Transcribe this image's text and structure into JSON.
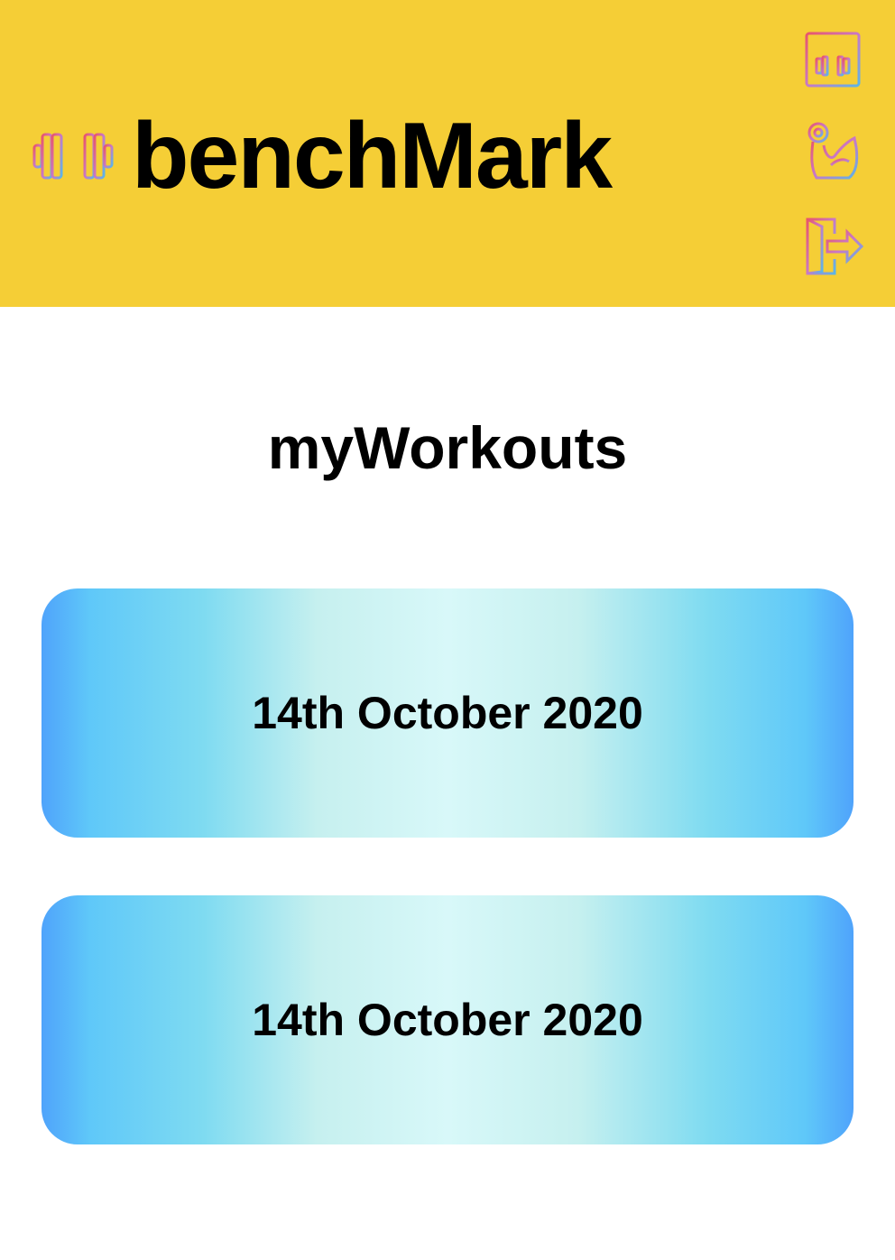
{
  "header": {
    "title": "benchMark",
    "logo_icon": "barbell-icon",
    "background_color": "#F5CE36",
    "nav": [
      {
        "icon": "calendar-workout-icon"
      },
      {
        "icon": "flexed-arm-icon"
      },
      {
        "icon": "logout-icon"
      }
    ]
  },
  "main": {
    "title": "myWorkouts",
    "workouts": [
      {
        "date": "14th October 2020"
      },
      {
        "date": "14th October 2020"
      }
    ]
  },
  "colors": {
    "card_edge": "#4FA3FB",
    "card_center": "#D8F8F9"
  }
}
